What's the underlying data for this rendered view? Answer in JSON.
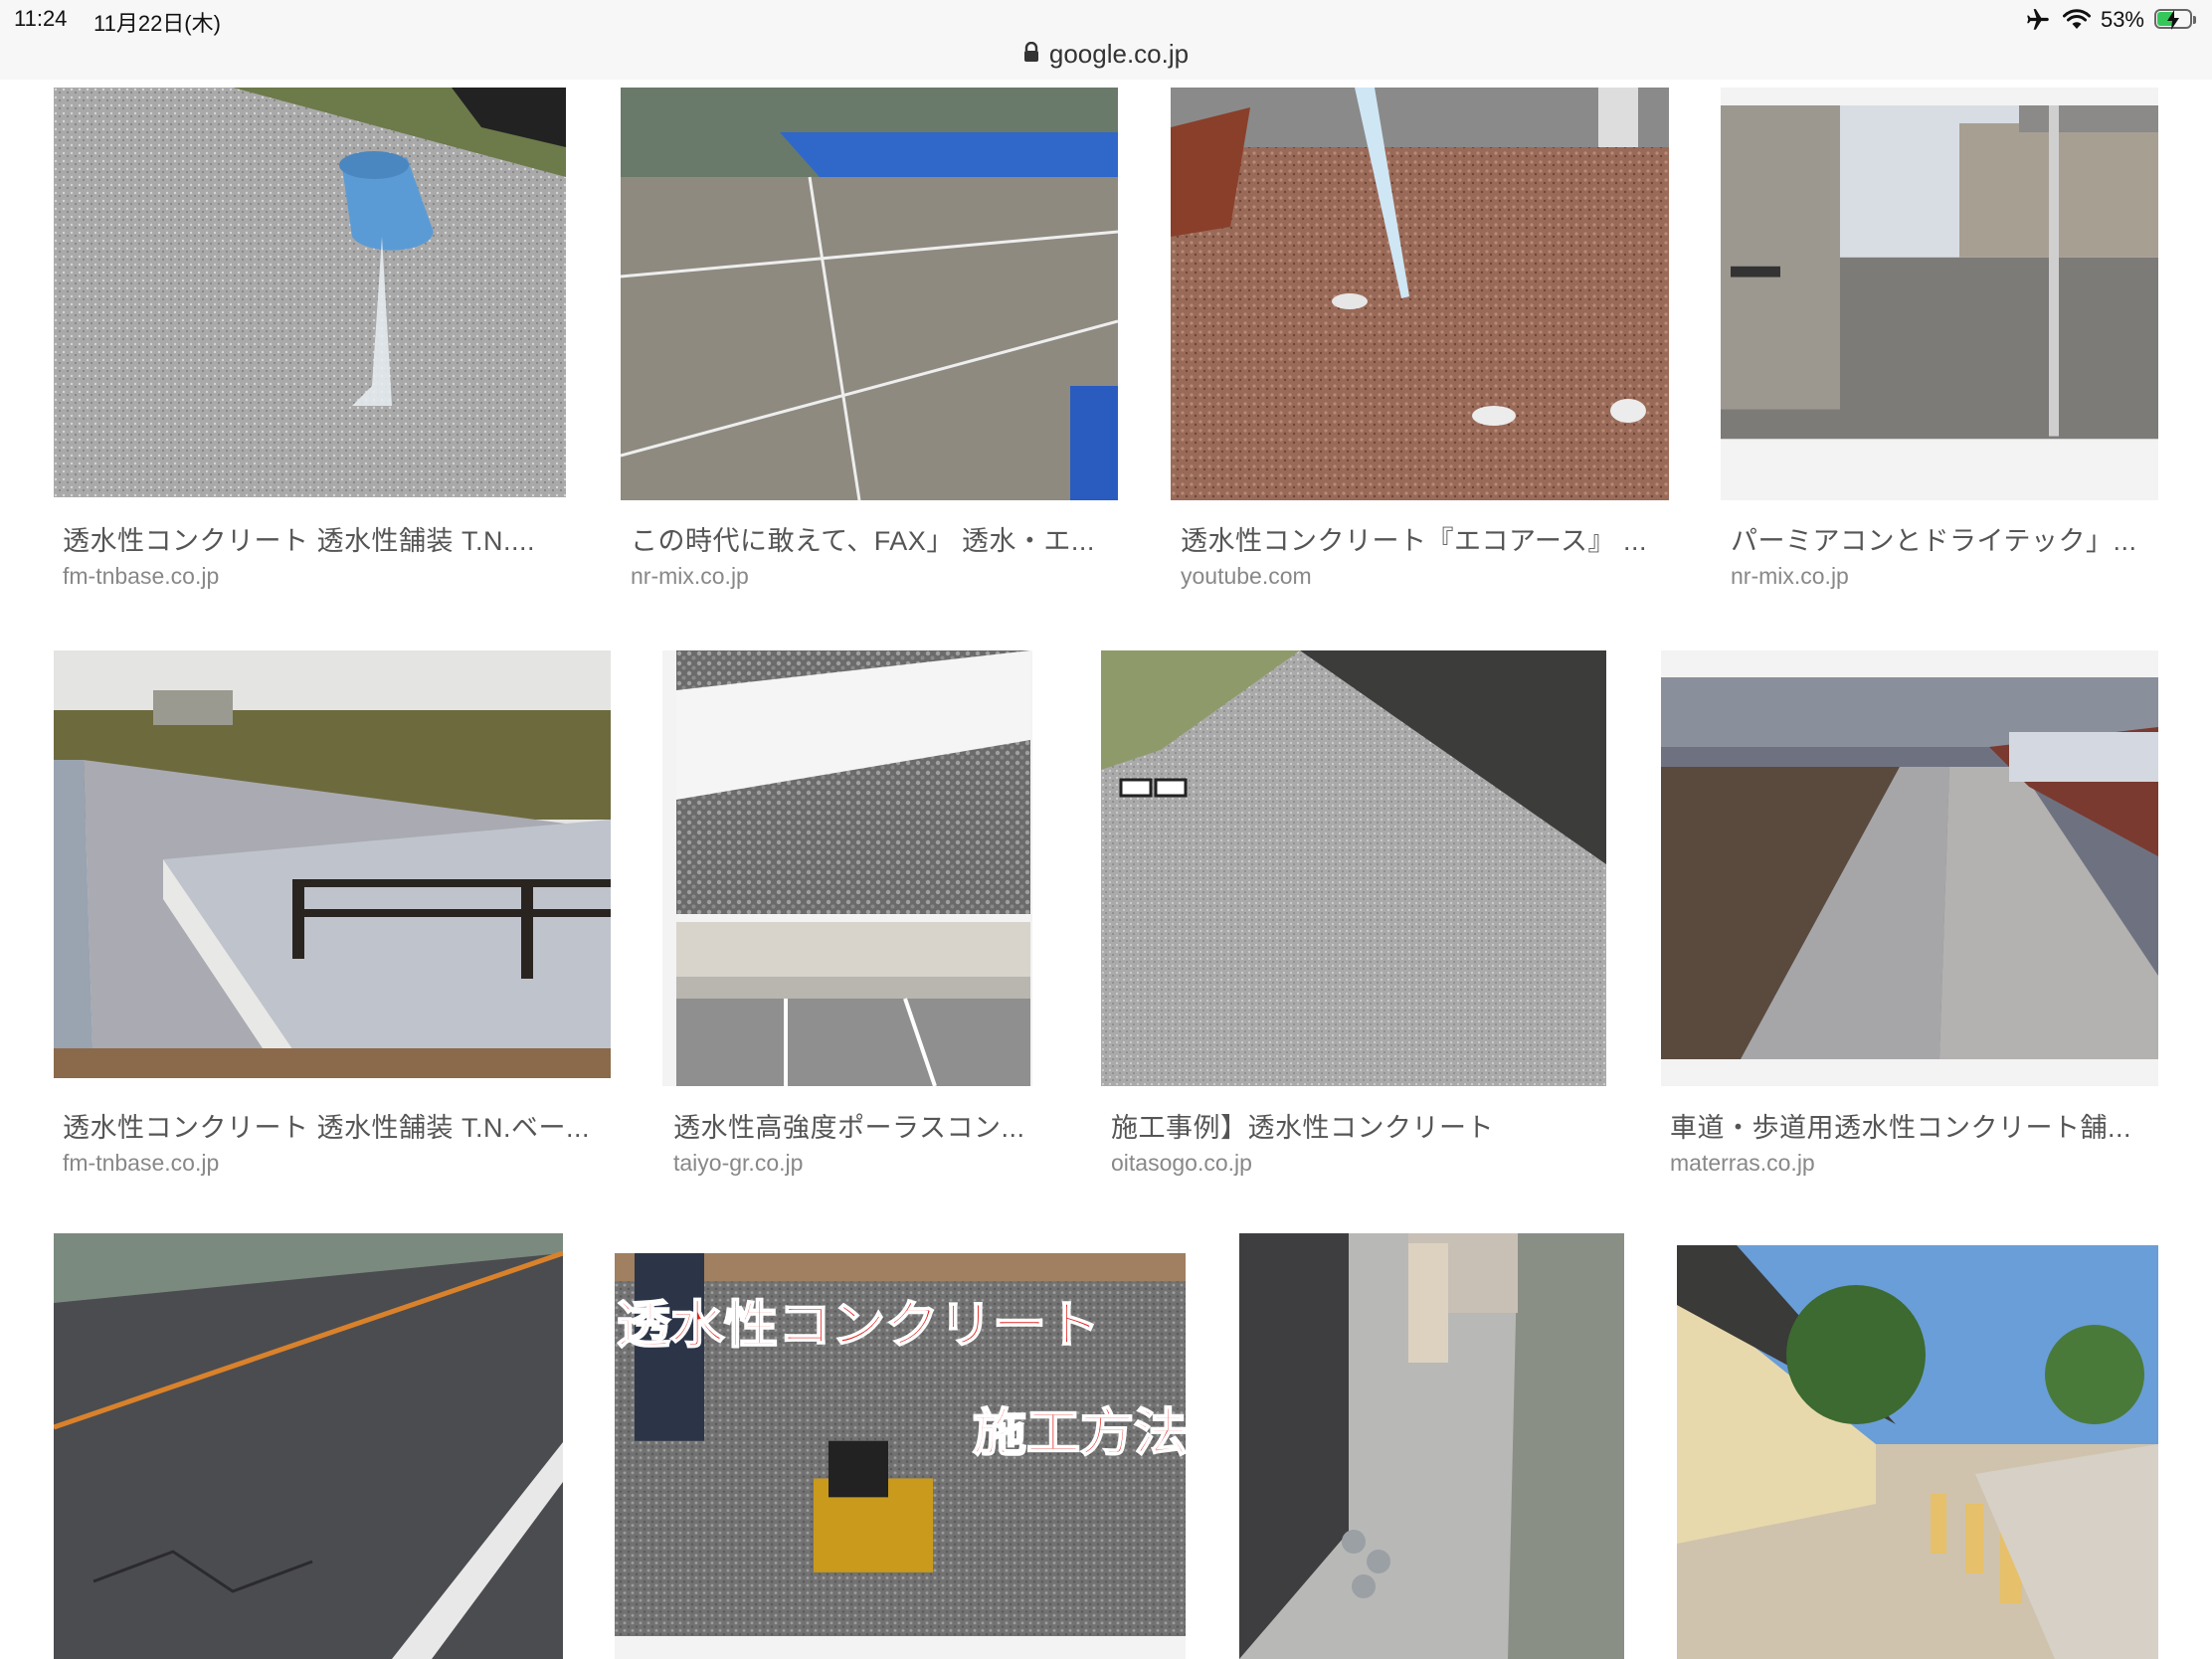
{
  "status_bar": {
    "time": "11:24",
    "date": "11月22日(木)",
    "battery_percent": "53%",
    "battery_level": 0.53,
    "icons": [
      "airplane-icon",
      "wifi-icon",
      "battery-charging-icon"
    ]
  },
  "url_bar": {
    "domain": "google.co.jp",
    "icon": "lock-icon"
  },
  "results": [
    {
      "title": "透水性コンクリート 透水性舗装 T.N....",
      "source": "fm-tnbase.co.jp"
    },
    {
      "title": "この時代に敢えて、FAX」 透水・エ...",
      "source": "nr-mix.co.jp"
    },
    {
      "title": "透水性コンクリート『エコアース』 ...",
      "source": "youtube.com"
    },
    {
      "title": "パーミアコンとドライテック」...",
      "source": "nr-mix.co.jp"
    },
    {
      "title": "透水性コンクリート 透水性舗装 T.N.ベー...",
      "source": "fm-tnbase.co.jp"
    },
    {
      "title": "透水性高強度ポーラスコン...",
      "source": "taiyo-gr.co.jp"
    },
    {
      "title": "施工事例】透水性コンクリート",
      "source": "oitasogo.co.jp"
    },
    {
      "title": "車道・歩道用透水性コンクリート舗...",
      "source": "materras.co.jp"
    },
    {
      "title": "",
      "source": ""
    },
    {
      "title": "",
      "source": ""
    },
    {
      "title": "",
      "source": ""
    },
    {
      "title": "",
      "source": ""
    }
  ],
  "thumbnail_overlay": {
    "line1": "透水性コンクリート",
    "line2": "施工方法"
  }
}
